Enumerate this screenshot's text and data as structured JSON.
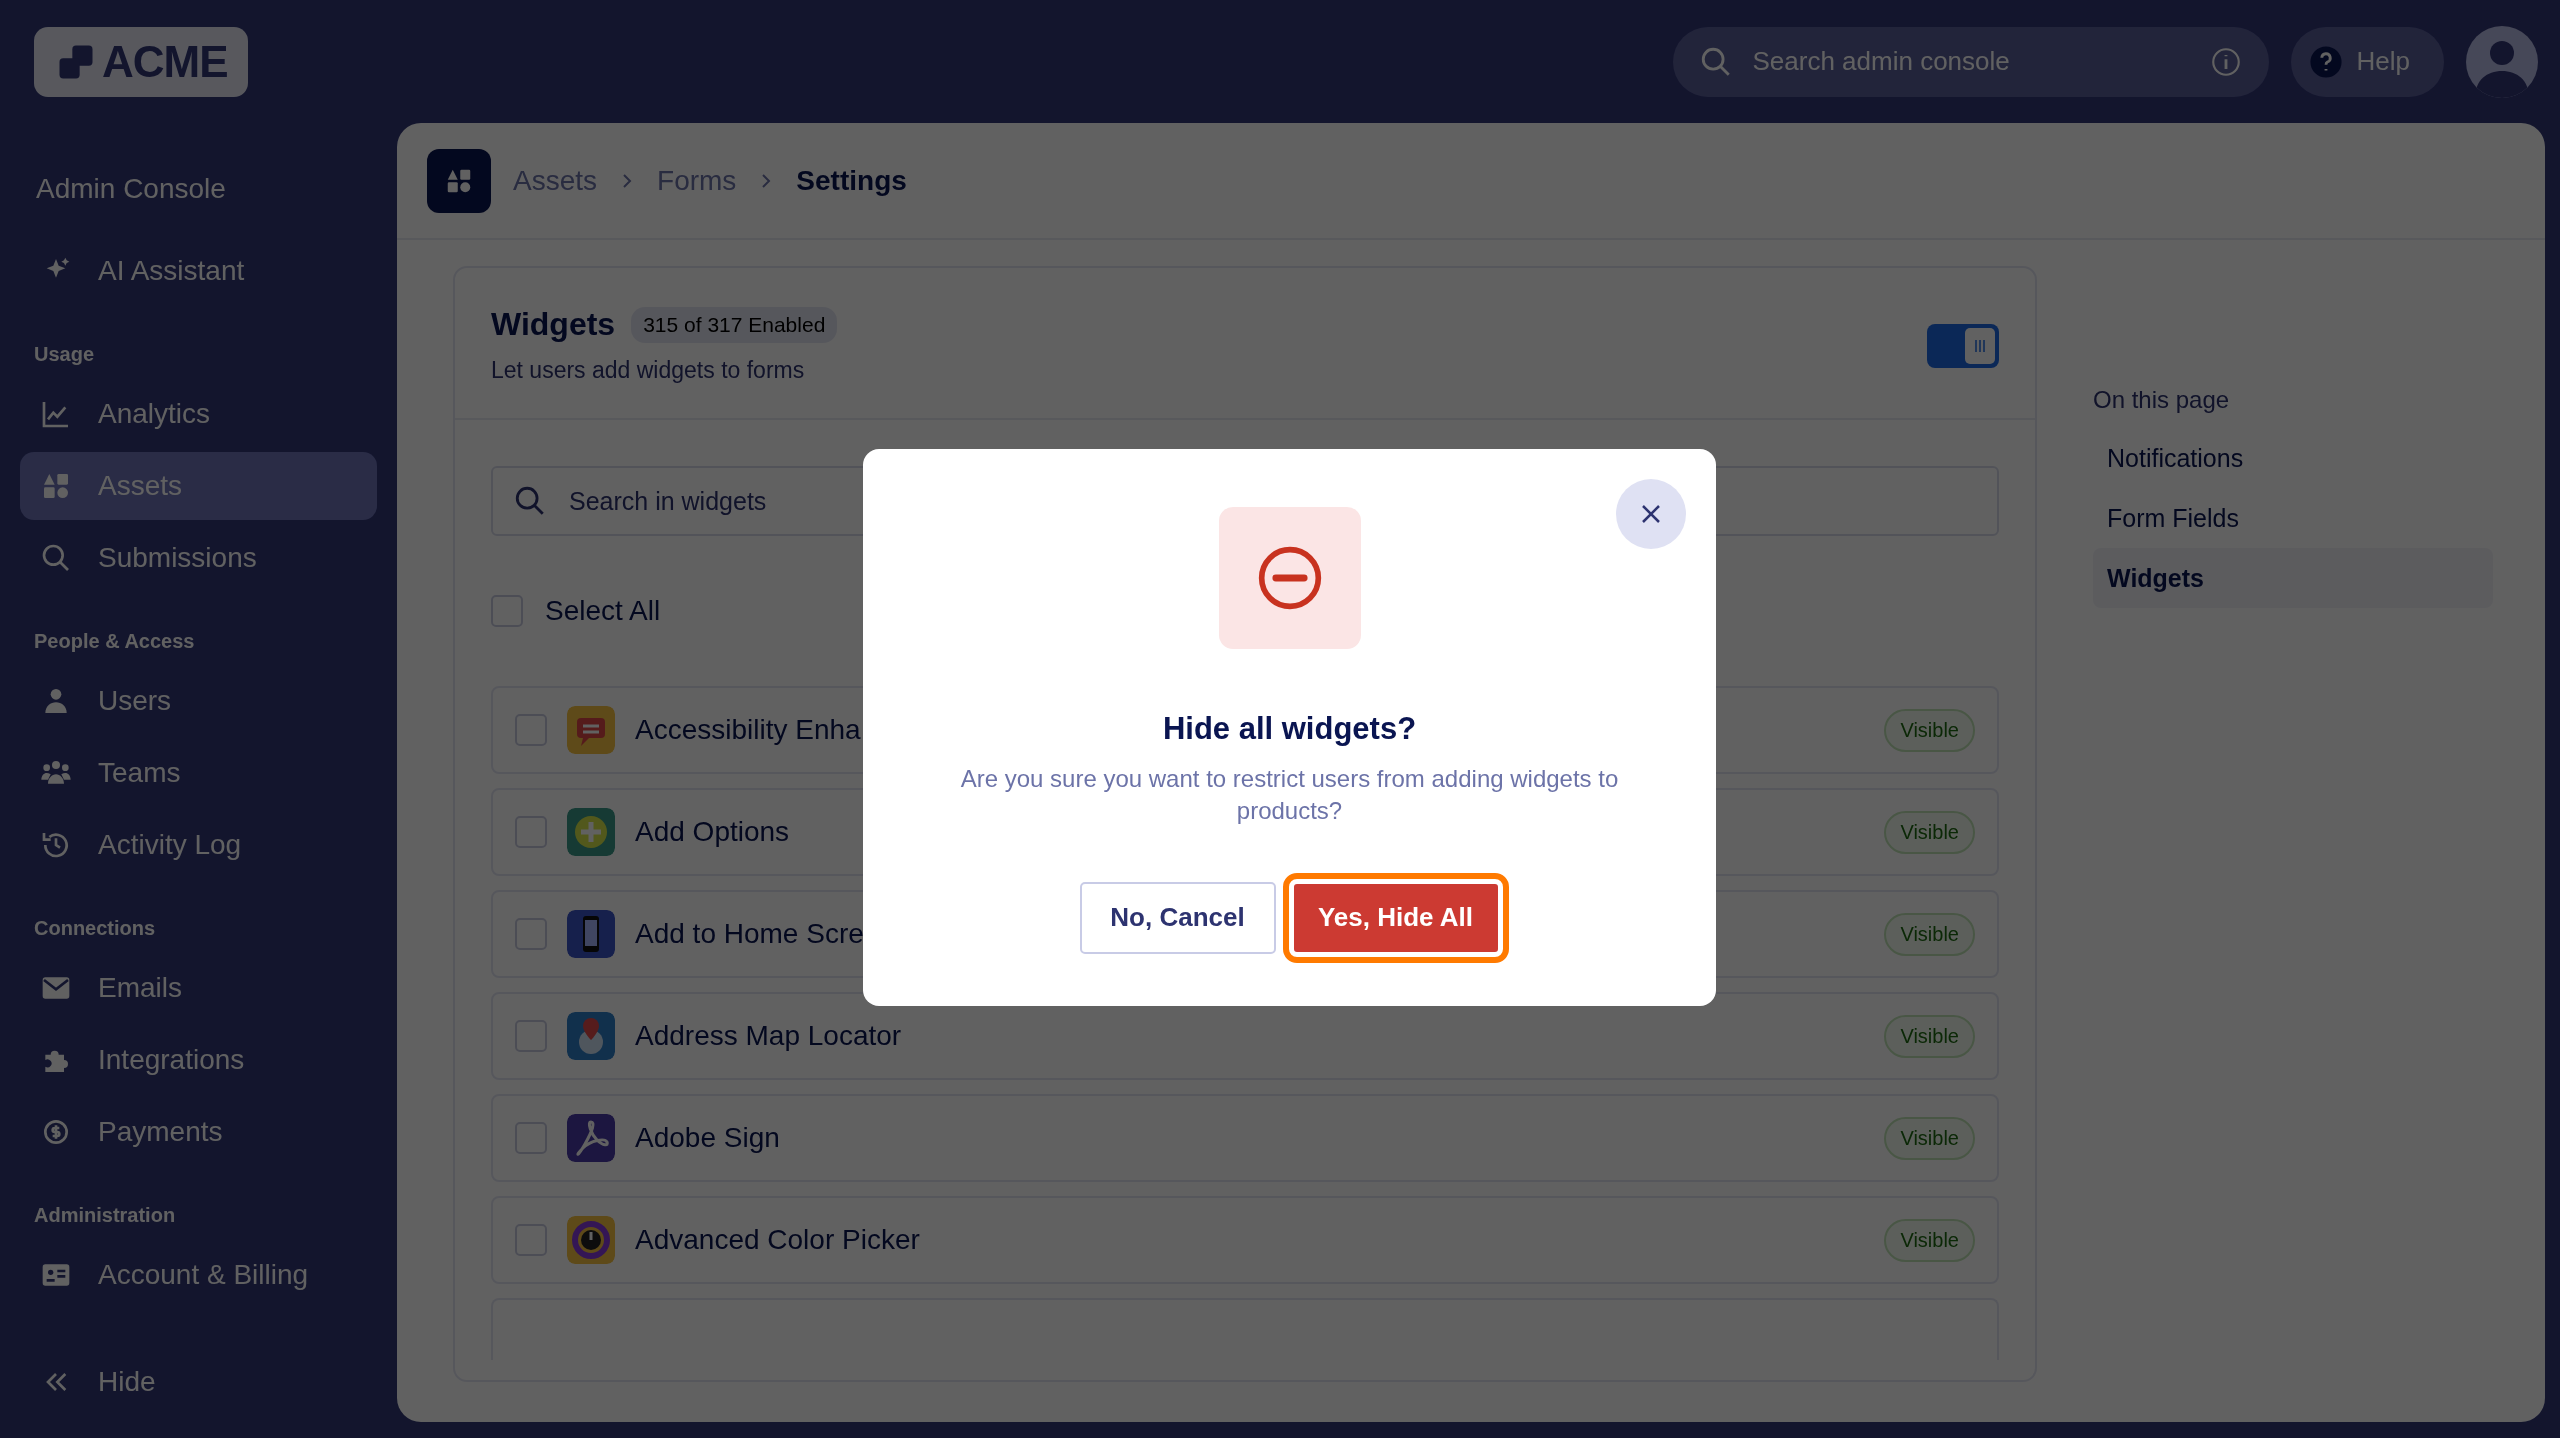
{
  "logo": {
    "text": "ACME"
  },
  "top_bar": {
    "search": {
      "placeholder": "Search admin console"
    },
    "help_button": "Help"
  },
  "sidebar": {
    "title": "Admin Console",
    "sections": [
      {
        "items": [
          {
            "label": "AI Assistant",
            "selected": false
          }
        ]
      },
      {
        "heading": "Usage",
        "items": [
          {
            "label": "Analytics",
            "selected": false
          },
          {
            "label": "Assets",
            "selected": true
          },
          {
            "label": "Submissions",
            "selected": false
          }
        ]
      },
      {
        "heading": "People & Access",
        "items": [
          {
            "label": "Users",
            "selected": false
          },
          {
            "label": "Teams",
            "selected": false
          },
          {
            "label": "Activity Log",
            "selected": false
          }
        ]
      },
      {
        "heading": "Connections",
        "items": [
          {
            "label": "Emails",
            "selected": false
          },
          {
            "label": "Integrations",
            "selected": false
          },
          {
            "label": "Payments",
            "selected": false
          }
        ]
      },
      {
        "heading": "Administration",
        "items": [
          {
            "label": "Account & Billing",
            "selected": false
          }
        ]
      }
    ],
    "hide_button": "Hide"
  },
  "breadcrumbs": [
    "Assets",
    "Forms",
    "Settings"
  ],
  "widgets_card": {
    "title": "Widgets",
    "count_badge": "315 of 317 Enabled",
    "subtitle": "Let users add widgets to forms",
    "enabled": true,
    "search": {
      "placeholder": "Search in widgets"
    },
    "select_all": {
      "label": "Select All",
      "checked": false
    },
    "rows": [
      {
        "name": "Accessibility Enha",
        "checked": false,
        "status": "Visible"
      },
      {
        "name": "Add Options",
        "checked": false,
        "status": "Visible"
      },
      {
        "name": "Add to Home Scre",
        "checked": false,
        "status": "Visible"
      },
      {
        "name": "Address Map Locator",
        "checked": false,
        "status": "Visible"
      },
      {
        "name": "Adobe Sign",
        "checked": false,
        "status": "Visible"
      },
      {
        "name": "Advanced Color Picker",
        "checked": false,
        "status": "Visible"
      }
    ]
  },
  "on_this_page": {
    "heading": "On this page",
    "items": [
      {
        "label": "Notifications",
        "selected": false
      },
      {
        "label": "Form Fields",
        "selected": false
      },
      {
        "label": "Widgets",
        "selected": true
      }
    ]
  },
  "dialog": {
    "title": "Hide all widgets?",
    "message": "Are you sure you want to restrict users from adding widgets to products?",
    "cancel_button": "No, Cancel",
    "confirm_button": "Yes, Hide All",
    "confirm_focused": true
  }
}
